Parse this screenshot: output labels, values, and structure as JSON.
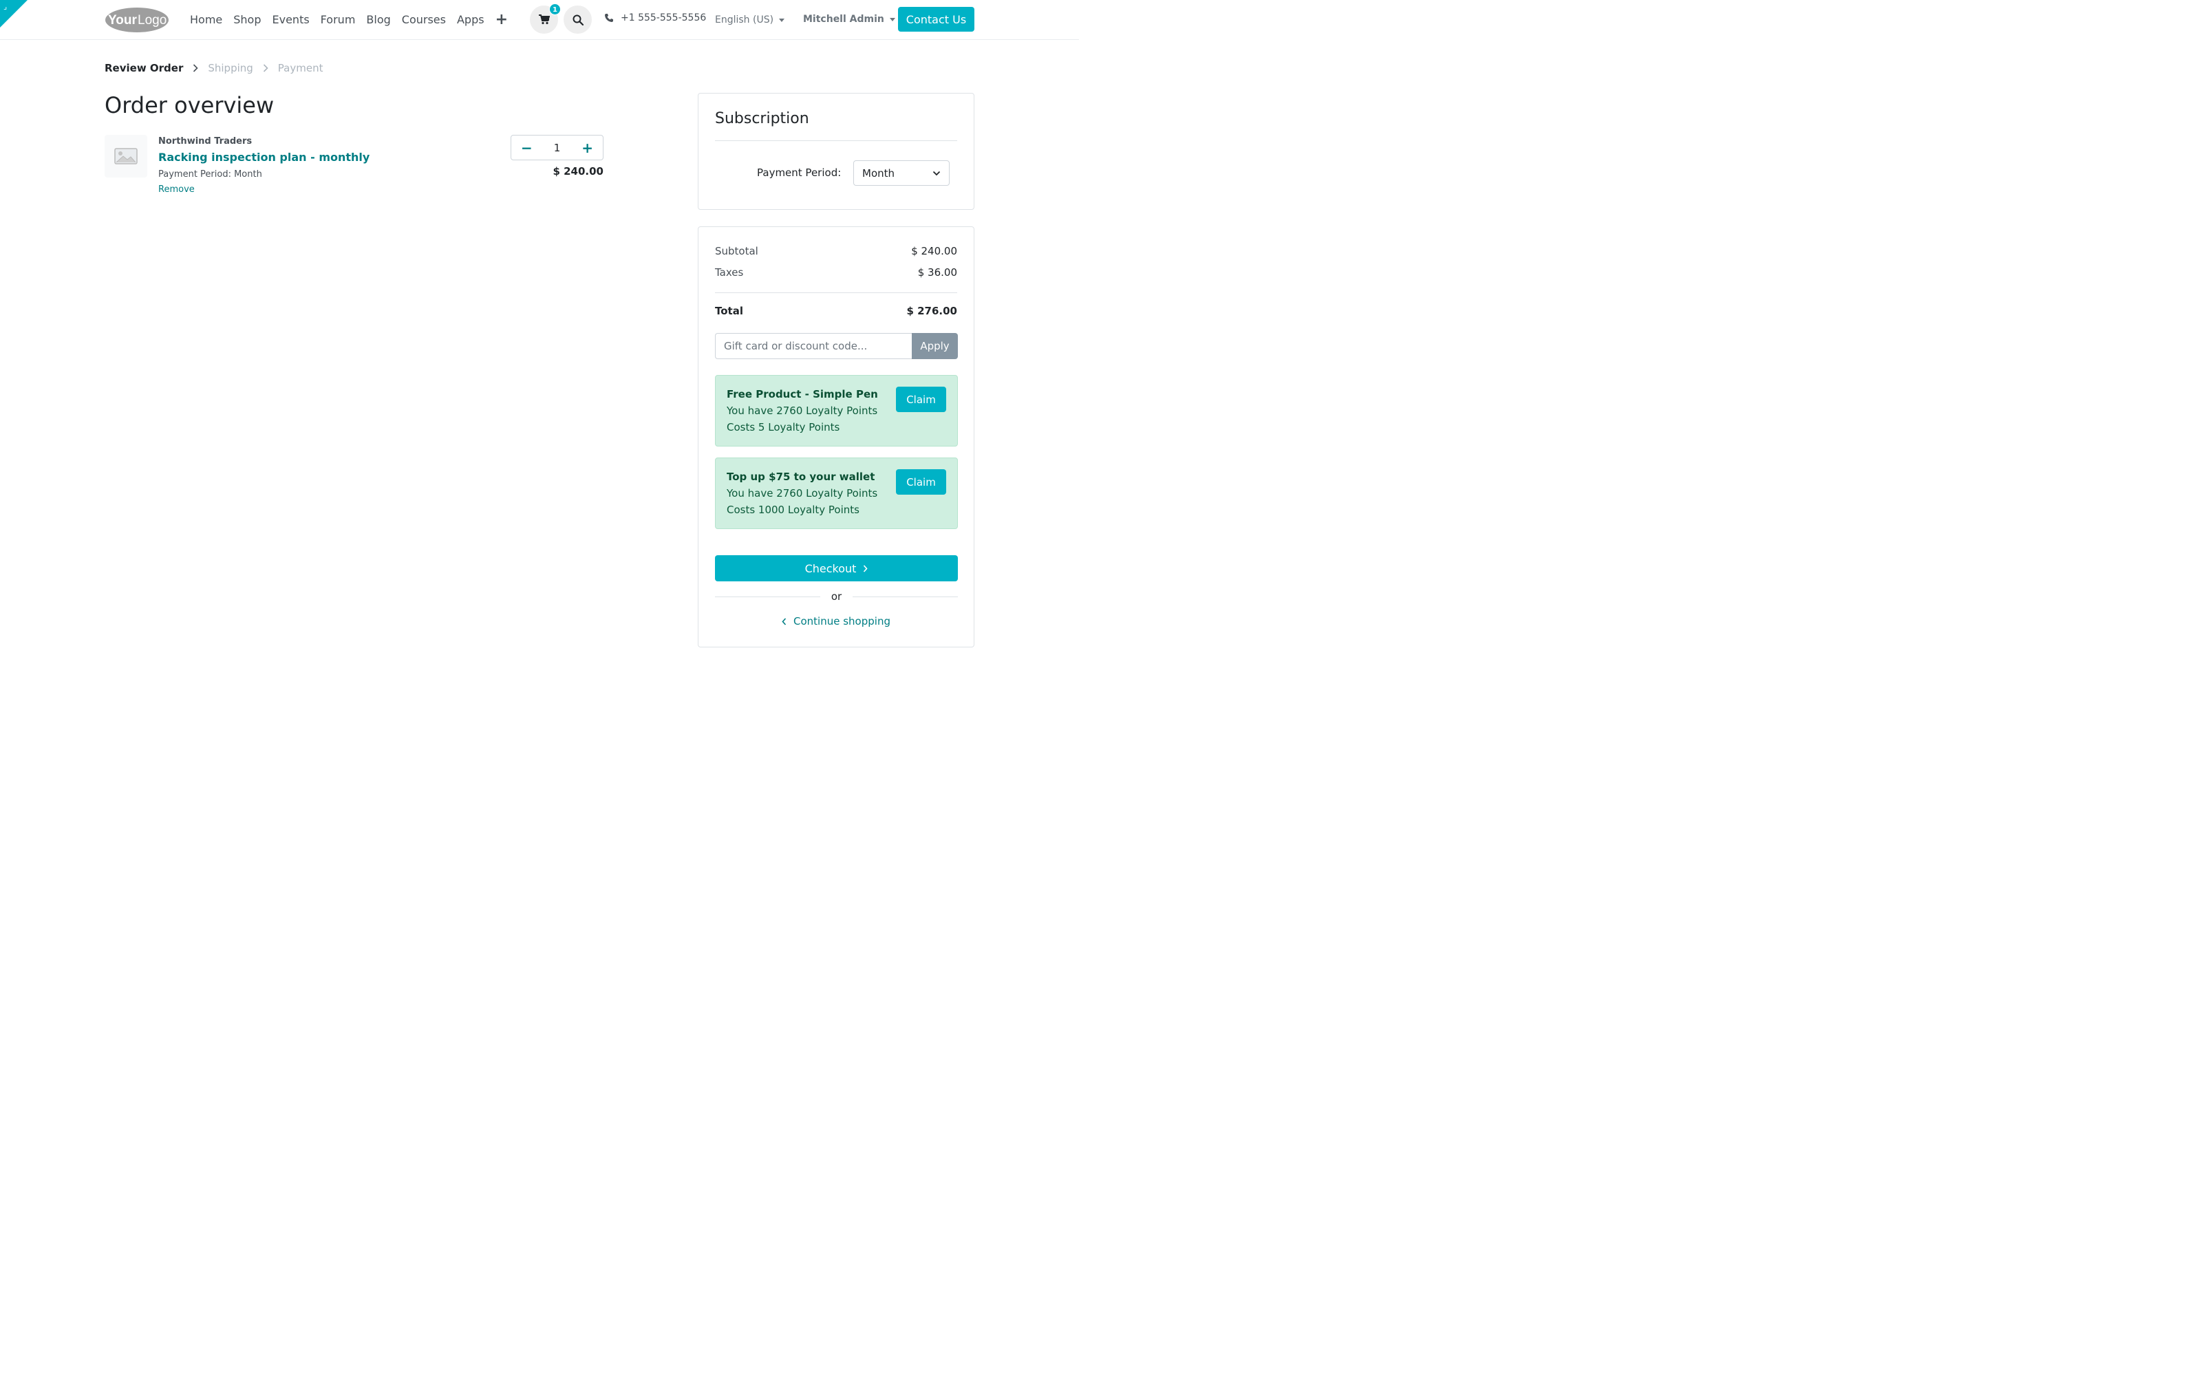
{
  "header": {
    "logo_text": "YourLogo",
    "nav": [
      "Home",
      "Shop",
      "Events",
      "Forum",
      "Blog",
      "Courses",
      "Apps"
    ],
    "cart_count": "1",
    "phone": "+1 555-555-5556",
    "language": "English (US)",
    "user": "Mitchell Admin",
    "contact_label": "Contact Us"
  },
  "steps": {
    "review": "Review Order",
    "shipping": "Shipping",
    "payment": "Payment"
  },
  "page_title": "Order overview",
  "order_line": {
    "vendor": "Northwind Traders",
    "product": "Racking inspection plan - monthly",
    "period": "Payment Period: Month",
    "remove": "Remove",
    "quantity": "1",
    "price": "$ 240.00"
  },
  "subscription": {
    "title": "Subscription",
    "period_label": "Payment Period:",
    "period_value": "Month"
  },
  "summary": {
    "subtotal_label": "Subtotal",
    "subtotal": "$ 240.00",
    "taxes_label": "Taxes",
    "taxes": "$ 36.00",
    "total_label": "Total",
    "total": "$ 276.00",
    "promo_placeholder": "Gift card or discount code...",
    "apply_label": "Apply"
  },
  "rewards": [
    {
      "title": "Free Product - Simple Pen",
      "points": "You have 2760 Loyalty Points",
      "cost": "Costs 5 Loyalty Points",
      "claim": "Claim"
    },
    {
      "title": "Top up $75 to your wallet",
      "points": "You have 2760 Loyalty Points",
      "cost": "Costs 1000 Loyalty Points",
      "claim": "Claim"
    }
  ],
  "checkout_label": "Checkout",
  "or_label": "or",
  "continue_label": "Continue shopping",
  "colors": {
    "primary": "#00b2c6",
    "link": "#017e84",
    "reward_bg": "#cfefe0",
    "apply_bg": "#8595a2"
  }
}
